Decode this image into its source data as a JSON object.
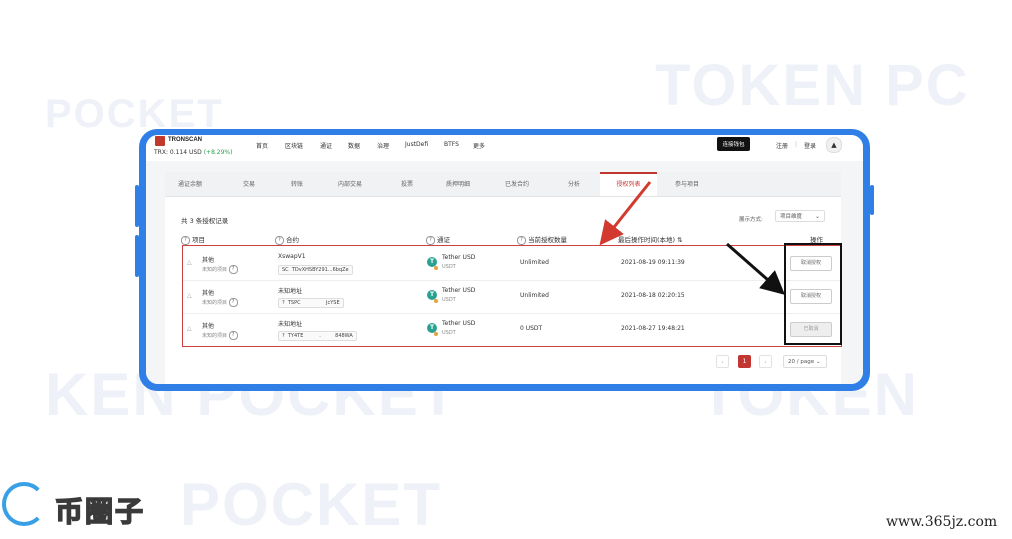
{
  "watermark": {
    "token_pc": "TOKEN PC",
    "pocket_top": "POCKET",
    "ken_pocket": "KEN POCKET",
    "token_br": "TOKEN",
    "pocket_bottom": "POCKET"
  },
  "topbar": {
    "logo": "TRONSCAN",
    "trx_price": "TRX: 0.114 USD",
    "trx_change": "(+8.29%)",
    "nav": [
      "首页",
      "区块链",
      "通证",
      "数据",
      "治理",
      "JustDefi",
      "BTFS",
      "更多"
    ],
    "connect_wallet": "连接钱包",
    "register": "注册",
    "separator": "|",
    "login": "登录"
  },
  "tabs": [
    "通证余额",
    "交易",
    "转账",
    "内部交易",
    "投票",
    "质押明细",
    "已发合约",
    "分析",
    "授权列表",
    "参与项目"
  ],
  "active_tab": 8,
  "summary": {
    "records": "共 3 条授权记录",
    "sort_label": "展示方式:",
    "sort_value": "项目维度"
  },
  "columns": {
    "project": "项目",
    "contract": "合约",
    "token": "通证",
    "amount": "当前授权数量",
    "time": "最后操作时间(本地)",
    "action": "操作"
  },
  "rows": [
    {
      "project": "其他",
      "project_sub": "未知的项目",
      "contract_name": "XswapV1",
      "addr_prefix": "SC",
      "addr": "TDvXHSBY291...6bqZe",
      "token": "Tether USD",
      "token_sym": "USDT",
      "amount": "Unlimited",
      "time": "2021-08-19 09:11:39",
      "action": "取消授权",
      "done": false
    },
    {
      "project": "其他",
      "project_sub": "未知的项目",
      "contract_name": "未知地址",
      "addr_prefix": "?",
      "addr": "TSPC                JcYSE",
      "token": "Tether USD",
      "token_sym": "USDT",
      "amount": "Unlimited",
      "time": "2021-08-18 02:20:15",
      "action": "取消授权",
      "done": false
    },
    {
      "project": "其他",
      "project_sub": "未知的项目",
      "contract_name": "未知地址",
      "addr_prefix": "?",
      "addr": "TY4TE          .         848WA",
      "token": "Tether USD",
      "token_sym": "USDT",
      "amount": "0 USDT",
      "time": "2021-08-27 19:48:21",
      "action": "已取消",
      "done": true
    }
  ],
  "pagination": {
    "prev": "‹",
    "current": "1",
    "next": "›",
    "page_size": "20 / page"
  },
  "brand": {
    "name": "币圈子",
    "site": "www.365jz.com"
  },
  "colors": {
    "frame": "#2f7fe6",
    "accent": "#c23631",
    "tether": "#2aa191",
    "annotation_red": "#d04040"
  }
}
